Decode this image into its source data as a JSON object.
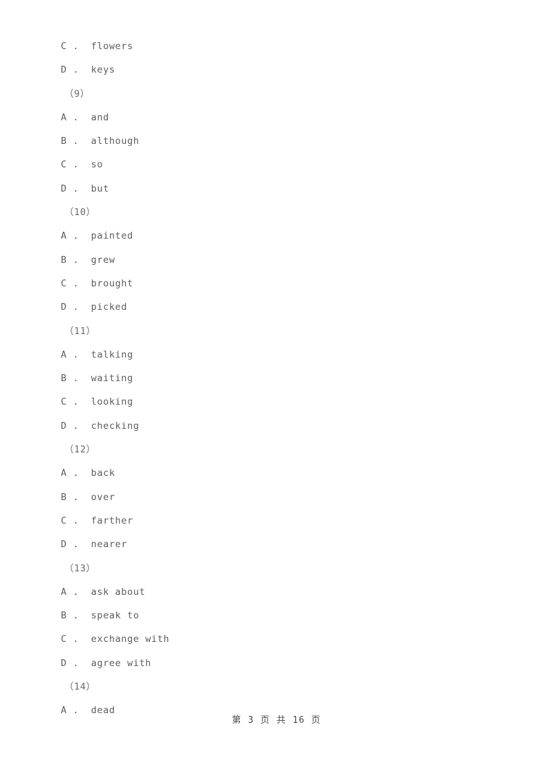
{
  "document": {
    "page_number": 3,
    "total_pages": 16,
    "footer_text": "第 3 页 共 16 页"
  },
  "lines": [
    {
      "kind": "option",
      "text": "C .  flowers"
    },
    {
      "kind": "option",
      "text": "D .  keys"
    },
    {
      "kind": "question",
      "text": "（9）"
    },
    {
      "kind": "option",
      "text": "A .  and"
    },
    {
      "kind": "option",
      "text": "B .  although"
    },
    {
      "kind": "option",
      "text": "C .  so"
    },
    {
      "kind": "option",
      "text": "D .  but"
    },
    {
      "kind": "question",
      "text": "（10）"
    },
    {
      "kind": "option",
      "text": "A .  painted"
    },
    {
      "kind": "option",
      "text": "B .  grew"
    },
    {
      "kind": "option",
      "text": "C .  brought"
    },
    {
      "kind": "option",
      "text": "D .  picked"
    },
    {
      "kind": "question",
      "text": "（11）"
    },
    {
      "kind": "option",
      "text": "A .  talking"
    },
    {
      "kind": "option",
      "text": "B .  waiting"
    },
    {
      "kind": "option",
      "text": "C .  looking"
    },
    {
      "kind": "option",
      "text": "D .  checking"
    },
    {
      "kind": "question",
      "text": "（12）"
    },
    {
      "kind": "option",
      "text": "A .  back"
    },
    {
      "kind": "option",
      "text": "B .  over"
    },
    {
      "kind": "option",
      "text": "C .  farther"
    },
    {
      "kind": "option",
      "text": "D .  nearer"
    },
    {
      "kind": "question",
      "text": "（13）"
    },
    {
      "kind": "option",
      "text": "A .  ask about"
    },
    {
      "kind": "option",
      "text": "B .  speak to"
    },
    {
      "kind": "option",
      "text": "C .  exchange with"
    },
    {
      "kind": "option",
      "text": "D .  agree with"
    },
    {
      "kind": "question",
      "text": "（14）"
    },
    {
      "kind": "option",
      "text": "A .  dead"
    }
  ],
  "questions": [
    {
      "number": "（9）",
      "options": [
        {
          "letter": "A",
          "text": "and"
        },
        {
          "letter": "B",
          "text": "although"
        },
        {
          "letter": "C",
          "text": "so"
        },
        {
          "letter": "D",
          "text": "but"
        }
      ]
    },
    {
      "number": "（10）",
      "options": [
        {
          "letter": "A",
          "text": "painted"
        },
        {
          "letter": "B",
          "text": "grew"
        },
        {
          "letter": "C",
          "text": "brought"
        },
        {
          "letter": "D",
          "text": "picked"
        }
      ]
    },
    {
      "number": "（11）",
      "options": [
        {
          "letter": "A",
          "text": "talking"
        },
        {
          "letter": "B",
          "text": "waiting"
        },
        {
          "letter": "C",
          "text": "looking"
        },
        {
          "letter": "D",
          "text": "checking"
        }
      ]
    },
    {
      "number": "（12）",
      "options": [
        {
          "letter": "A",
          "text": "back"
        },
        {
          "letter": "B",
          "text": "over"
        },
        {
          "letter": "C",
          "text": "farther"
        },
        {
          "letter": "D",
          "text": "nearer"
        }
      ]
    },
    {
      "number": "（13）",
      "options": [
        {
          "letter": "A",
          "text": "ask about"
        },
        {
          "letter": "B",
          "text": "speak to"
        },
        {
          "letter": "C",
          "text": "exchange with"
        },
        {
          "letter": "D",
          "text": "agree with"
        }
      ]
    },
    {
      "number": "（14）",
      "options": [
        {
          "letter": "A",
          "text": "dead"
        }
      ]
    }
  ],
  "colors": {
    "page_background": "#ffffff",
    "body_text": "#5c5c5c",
    "footer_text": "#4a4a4a"
  }
}
